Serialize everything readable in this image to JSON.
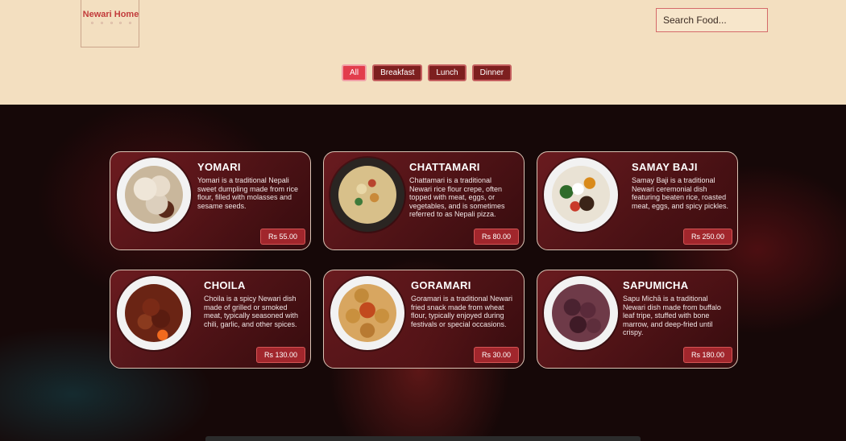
{
  "header": {
    "logo_text": "Newari Home",
    "search_placeholder": "Search Food..."
  },
  "filters": [
    {
      "label": "All",
      "active": true
    },
    {
      "label": "Breakfast",
      "active": false
    },
    {
      "label": "Lunch",
      "active": false
    },
    {
      "label": "Dinner",
      "active": false
    }
  ],
  "dishes": [
    {
      "name": "YOMARI",
      "description": "Yomari is a traditional Nepali sweet dumpling made from rice flour, filled with molasses and sesame seeds.",
      "price": "Rs 55.00"
    },
    {
      "name": "CHATTAMARI",
      "description": "Chattamari is a traditional Newari rice flour crepe, often topped with meat, eggs, or vegetables, and is sometimes referred to as Nepali pizza.",
      "price": "Rs 80.00"
    },
    {
      "name": "SAMAY BAJI",
      "description": "Samay Baji is a traditional Newari ceremonial dish featuring beaten rice, roasted meat, eggs, and spicy pickles.",
      "price": "Rs 250.00"
    },
    {
      "name": "CHOILA",
      "description": "Choila is a spicy Newari dish made of grilled or smoked meat, typically seasoned with chili, garlic, and other spices.",
      "price": "Rs 130.00"
    },
    {
      "name": "GORAMARI",
      "description": "Goramari is a traditional Newari fried snack made from wheat flour, typically enjoyed during festivals or special occasions.",
      "price": "Rs 30.00"
    },
    {
      "name": "SAPUMICHA",
      "description": "Sapu Michā is a traditional Newari dish made from buffalo leaf tripe, stuffed with bone marrow, and deep-fried until crispy.",
      "price": "Rs 180.00"
    }
  ],
  "colors": {
    "header_bg": "#f3dfc0",
    "accent": "#e23d4c",
    "button": "#7d1f1f",
    "price_bg": "#a1262c"
  }
}
